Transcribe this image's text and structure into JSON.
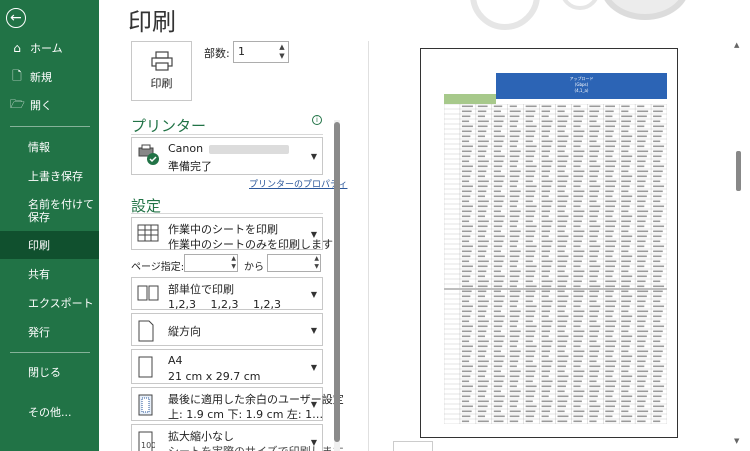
{
  "nav": {
    "back_icon": "back-arrow-icon",
    "items": [
      {
        "label": "ホーム",
        "icon": "home-icon"
      },
      {
        "label": "新規",
        "icon": "new-file-icon"
      },
      {
        "label": "開く",
        "icon": "folder-open-icon"
      }
    ],
    "plain_items": [
      "情報",
      "上書き保存",
      "名前を付けて保存",
      "印刷",
      "共有",
      "エクスポート",
      "発行",
      "閉じる",
      "その他..."
    ],
    "active": "印刷",
    "accent": "#217346"
  },
  "title": "印刷",
  "print_button_label": "印刷",
  "copies": {
    "label": "部数:",
    "value": "1"
  },
  "printer": {
    "heading": "プリンター",
    "name": "Canon",
    "status": "準備完了",
    "properties_link": "プリンターのプロパティ"
  },
  "settings": {
    "heading": "設定",
    "scope": {
      "title": "作業中のシートを印刷",
      "desc": "作業中のシートのみを印刷します"
    },
    "pages": {
      "label": "ページ指定:",
      "to_label": "から"
    },
    "collate": {
      "title": "部単位で印刷",
      "desc": "1,2,3　 1,2,3　 1,2,3"
    },
    "orientation": {
      "title": "縦方向"
    },
    "paper": {
      "title": "A4",
      "desc": "21 cm x 29.7 cm"
    },
    "margins": {
      "title": "最後に適用した余白のユーザー設定",
      "desc": "上: 1.9 cm 下: 1.9 cm 左: 1…"
    },
    "scaling": {
      "title": "拡大縮小なし",
      "desc": "シートを実際のサイズで印刷します"
    }
  },
  "preview": {
    "sheet_title": "アップロード",
    "sheet_sub1": "(Gbps)",
    "sheet_sub2": "(4,1_a)"
  }
}
